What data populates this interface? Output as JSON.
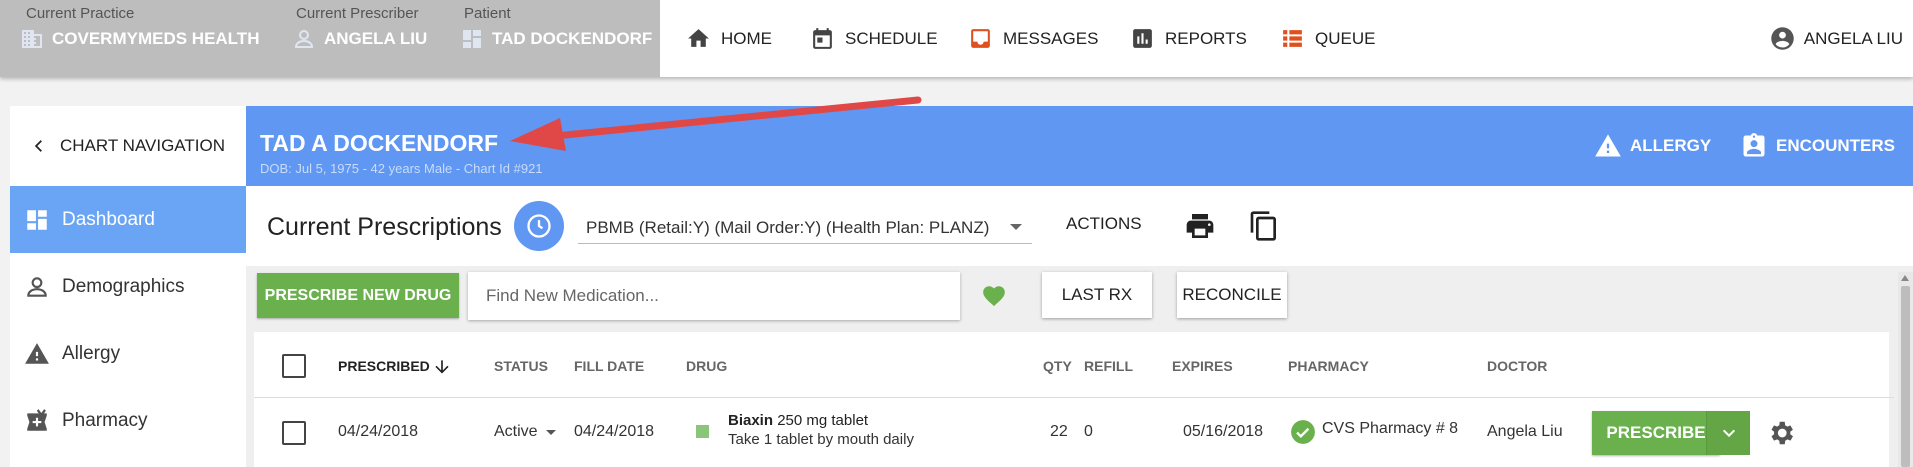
{
  "context": {
    "practice_label": "Current Practice",
    "practice_value": "COVERMYMEDS HEALTH",
    "prescriber_label": "Current Prescriber",
    "prescriber_value": "ANGELA LIU",
    "patient_label": "Patient",
    "patient_value": "TAD DOCKENDORF"
  },
  "nav": {
    "home": "HOME",
    "schedule": "SCHEDULE",
    "messages": "MESSAGES",
    "reports": "REPORTS",
    "queue": "QUEUE",
    "user": "ANGELA LIU"
  },
  "sidebar": {
    "chart_nav": "CHART NAVIGATION",
    "items": [
      {
        "label": "Dashboard"
      },
      {
        "label": "Demographics"
      },
      {
        "label": "Allergy"
      },
      {
        "label": "Pharmacy"
      }
    ]
  },
  "patient": {
    "name": "TAD A DOCKENDORF",
    "details": "DOB: Jul 5, 1975 - 42 years Male - Chart Id #921",
    "allergy_button": "ALLERGY",
    "encounters_button": "ENCOUNTERS"
  },
  "prescriptions": {
    "title": "Current Prescriptions",
    "plan_selected": "PBMB (Retail:Y) (Mail Order:Y) (Health Plan: PLANZ)",
    "actions": "ACTIONS",
    "prescribe_new": "PRESCRIBE NEW DRUG",
    "search_placeholder": "Find New Medication...",
    "last_rx": "LAST RX",
    "reconcile": "RECONCILE"
  },
  "table": {
    "headers": {
      "prescribed": "PRESCRIBED",
      "status": "STATUS",
      "fill_date": "FILL DATE",
      "drug": "DRUG",
      "qty": "QTY",
      "refill": "REFILL",
      "expires": "EXPIRES",
      "pharmacy": "PHARMACY",
      "doctor": "DOCTOR"
    },
    "rows": [
      {
        "prescribed": "04/24/2018",
        "status": "Active",
        "fill_date": "04/24/2018",
        "drug_name": "Biaxin",
        "drug_strength": "250 mg tablet",
        "sig": "Take 1 tablet by mouth daily",
        "qty": "22",
        "refill": "0",
        "expires": "05/16/2018",
        "pharmacy": "CVS Pharmacy # 8",
        "doctor": "Angela Liu",
        "prescribe_button": "PRESCRIBE"
      }
    ]
  },
  "colors": {
    "header_blue": "#5f97f3",
    "green": "#6ab04c",
    "annotation_arrow": "#e04848"
  }
}
